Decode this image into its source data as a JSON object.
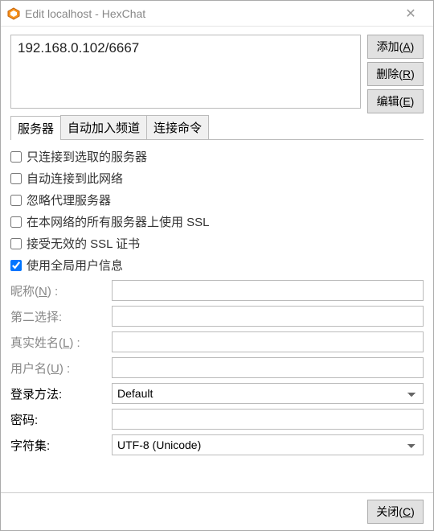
{
  "window": {
    "title": "Edit localhost - HexChat"
  },
  "servers": {
    "entries": [
      "192.168.0.102/6667"
    ]
  },
  "sideButtons": {
    "add": {
      "text": "添加(",
      "key": "A",
      "suffix": ")"
    },
    "remove": {
      "text": "删除(",
      "key": "R",
      "suffix": ")"
    },
    "edit": {
      "text": "编辑(",
      "key": "E",
      "suffix": ")"
    }
  },
  "tabs": {
    "servers": "服务器",
    "autojoin": "自动加入频道",
    "connect_cmds": "连接命令"
  },
  "checks": {
    "only_selected": {
      "label": "只连接到选取的服务器",
      "checked": false
    },
    "auto_connect": {
      "label": "自动连接到此网络",
      "checked": false
    },
    "bypass_proxy": {
      "label": "忽略代理服务器",
      "checked": false
    },
    "use_ssl": {
      "label": "在本网络的所有服务器上使用 SSL",
      "checked": false
    },
    "accept_invalid": {
      "label": "接受无效的 SSL 证书",
      "checked": false
    },
    "global_user": {
      "label": "使用全局用户信息",
      "checked": true
    }
  },
  "form": {
    "nickname": {
      "label": "昵称(",
      "key": "N",
      "suffix": ") :",
      "value": ""
    },
    "second_choice": {
      "label": "第二选择:",
      "value": ""
    },
    "realname": {
      "label": "真实姓名(",
      "key": "L",
      "suffix": ") :",
      "value": ""
    },
    "username": {
      "label": "用户名(",
      "key": "U",
      "suffix": ") :",
      "value": ""
    },
    "login_method": {
      "label": "登录方法:",
      "value": "Default"
    },
    "password": {
      "label": "密码:",
      "value": ""
    },
    "charset": {
      "label": "字符集:",
      "value": "UTF-8 (Unicode)"
    }
  },
  "footer": {
    "close": {
      "text": "关闭(",
      "key": "C",
      "suffix": ")"
    }
  }
}
